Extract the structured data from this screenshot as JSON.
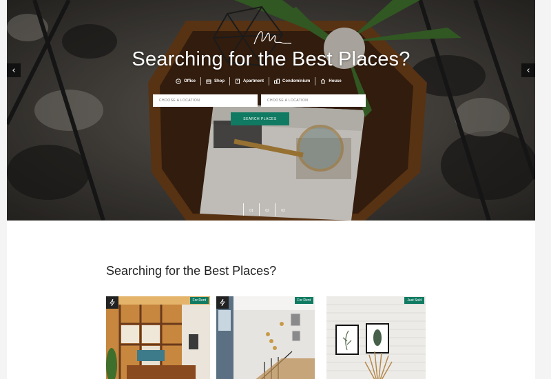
{
  "hero": {
    "title": "Searching for the Best Places?",
    "prev_icon": "chevron-left-icon",
    "next_icon": "chevron-left-icon",
    "prev_glyph": "‹",
    "next_glyph": "‹",
    "property_types": [
      {
        "label": "Office",
        "icon": "office-icon"
      },
      {
        "label": "Shop",
        "icon": "shop-icon"
      },
      {
        "label": "Apartment",
        "icon": "apartment-icon"
      },
      {
        "label": "Condominium",
        "icon": "condominium-icon"
      },
      {
        "label": "House",
        "icon": "house-icon"
      }
    ],
    "location_1_placeholder": "CHOOSE A LOCATION",
    "location_2_placeholder": "CHOOSE A LOCATION",
    "search_label": "SEARCH PLACES",
    "slides": [
      "01",
      "02",
      "03"
    ]
  },
  "listings": {
    "title": "Searching for the Best Places?",
    "cards": [
      {
        "badge": "For Rent",
        "icon": "lightning-icon"
      },
      {
        "badge": "For Rent",
        "icon": "lightning-icon"
      },
      {
        "badge": "Just Sold",
        "icon": null
      }
    ]
  },
  "colors": {
    "accent": "#107b62",
    "dark": "#111111"
  }
}
